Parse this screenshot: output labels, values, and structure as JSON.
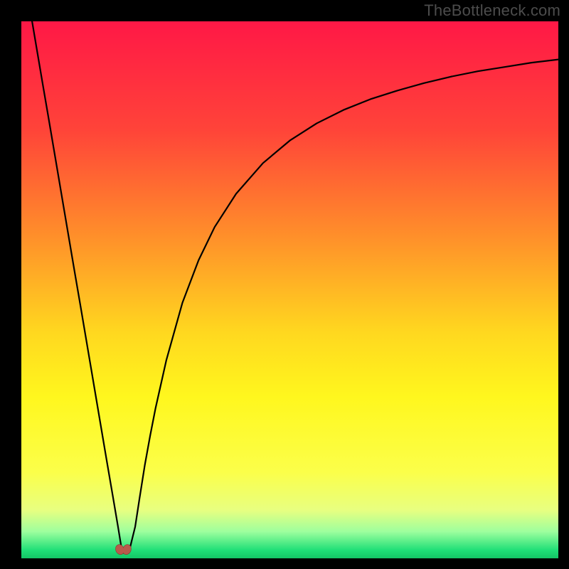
{
  "watermark": {
    "text": "TheBottleneck.com"
  },
  "chart_data": {
    "type": "line",
    "title": "",
    "xlabel": "",
    "ylabel": "",
    "xlim": [
      0,
      100
    ],
    "ylim": [
      0,
      100
    ],
    "series": [
      {
        "name": "bottleneck-curve",
        "x": [
          2,
          3,
          4,
          5,
          6,
          7,
          8,
          9,
          10,
          11,
          12,
          13,
          14,
          15,
          16,
          17,
          18,
          18.8,
          20,
          21.2,
          22,
          23,
          24,
          25,
          27,
          30,
          33,
          36,
          40,
          45,
          50,
          55,
          60,
          65,
          70,
          75,
          80,
          85,
          90,
          95,
          100
        ],
        "y": [
          100,
          94.1,
          88.2,
          82.4,
          76.5,
          70.6,
          64.7,
          58.8,
          52.9,
          47.1,
          41.2,
          35.3,
          29.4,
          23.5,
          17.6,
          11.8,
          5.9,
          1.0,
          1.0,
          5.9,
          11.1,
          17.4,
          22.9,
          28.0,
          36.9,
          47.6,
          55.5,
          61.7,
          67.9,
          73.6,
          77.8,
          81.0,
          83.5,
          85.5,
          87.1,
          88.5,
          89.7,
          90.7,
          91.5,
          92.3,
          92.9
        ]
      }
    ],
    "marker": {
      "name": "optimal-point",
      "x": 19,
      "y": 1.4
    },
    "background": {
      "type": "vertical-gradient",
      "stops": [
        {
          "pos": 0,
          "color": "#ff1846"
        },
        {
          "pos": 0.2,
          "color": "#ff4339"
        },
        {
          "pos": 0.4,
          "color": "#ff8f2a"
        },
        {
          "pos": 0.58,
          "color": "#ffd81f"
        },
        {
          "pos": 0.7,
          "color": "#fff71e"
        },
        {
          "pos": 0.84,
          "color": "#fbff4a"
        },
        {
          "pos": 0.91,
          "color": "#e8ff80"
        },
        {
          "pos": 0.95,
          "color": "#9eff9e"
        },
        {
          "pos": 0.985,
          "color": "#1fdf77"
        },
        {
          "pos": 1.0,
          "color": "#14c566"
        }
      ]
    }
  }
}
